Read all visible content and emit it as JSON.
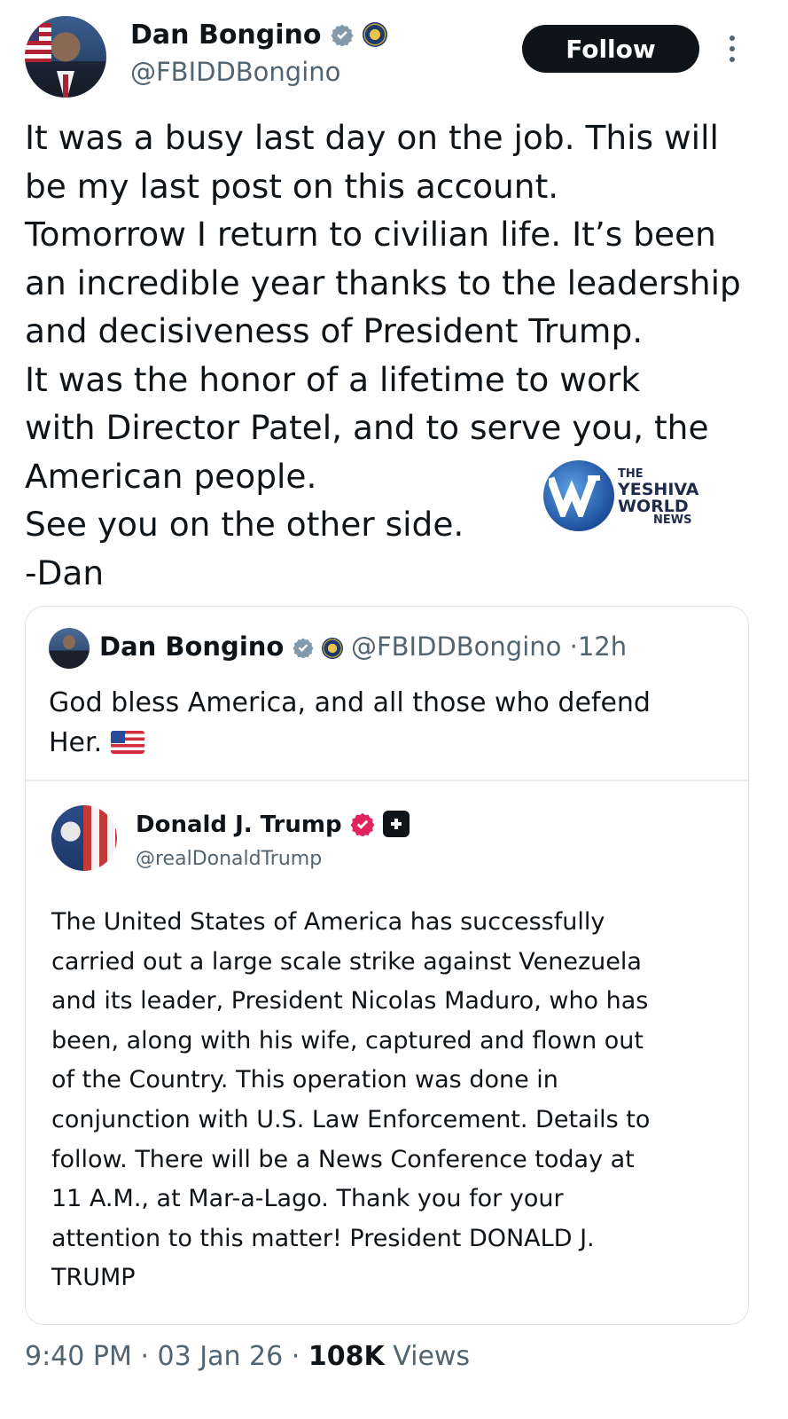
{
  "post": {
    "author_name": "Dan Bongino",
    "author_handle": "@FBIDDBongino",
    "follow_label": "Follow",
    "lines": [
      "It was a busy last day on the job. This will",
      "be my last post on this account.",
      "Tomorrow I return to civilian life. It’s been",
      "an incredible year thanks to the leadership",
      "and decisiveness of President Trump.",
      "It was the honor of a lifetime to work",
      "with Director Patel, and to serve you, the",
      "American people.",
      "See you on the other side.",
      "-Dan"
    ],
    "time": "9:40 PM",
    "date": "03 Jan 26",
    "views_count": "108K",
    "views_label": "Views",
    "separator": "·"
  },
  "watermark": {
    "line1": "THE",
    "line2": "YESHIVA",
    "line3": "WORLD",
    "line4": "NEWS"
  },
  "quote": {
    "author_name": "Dan Bongino",
    "author_handle": "@FBIDDBongino",
    "age": "12h",
    "line1": "God bless America, and all those who defend",
    "line2": "Her."
  },
  "inner_quote": {
    "author_name": "Donald J. Trump",
    "author_handle": "@realDonaldTrump",
    "lines": [
      "The United States of America has successfully",
      "carried out a large scale strike against Venezuela",
      "and its leader, President Nicolas Maduro, who has",
      "been, along with his wife, captured and flown out",
      "of the Country. This operation was done in",
      "conjunction with U.S. Law Enforcement. Details to",
      "follow. There will be a News Conference today at",
      "11 A.M., at Mar-a-Lago. Thank you for your",
      "attention to this matter! President DONALD J.",
      "TRUMP"
    ]
  },
  "colors": {
    "verified_blue": "#1d9bf0",
    "verified_red": "#e0245e",
    "muted_text": "#536471",
    "text": "#0f1419"
  }
}
